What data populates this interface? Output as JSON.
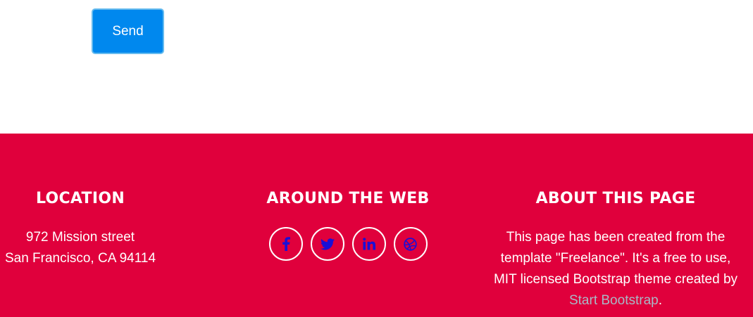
{
  "form": {
    "send_label": "Send"
  },
  "footer": {
    "location": {
      "heading": "LOCATION",
      "line1": "972 Mission street",
      "line2": "San Francisco, CA 94114"
    },
    "web": {
      "heading": "AROUND THE WEB",
      "icons": [
        "facebook-icon",
        "twitter-icon",
        "linkedin-icon",
        "dribbble-icon"
      ]
    },
    "about": {
      "heading": "ABOUT THIS PAGE",
      "text_before": "This page has been created from the template \"Freelance\". It's a free to use, MIT licensed Bootstrap theme created by ",
      "link_text": "Start Bootstrap",
      "text_after": "."
    }
  },
  "colors": {
    "footer_bg": "#e0003c",
    "button_bg": "#0088ee",
    "icon_color": "#1a0fd6",
    "link_color": "#a9b8c6"
  }
}
